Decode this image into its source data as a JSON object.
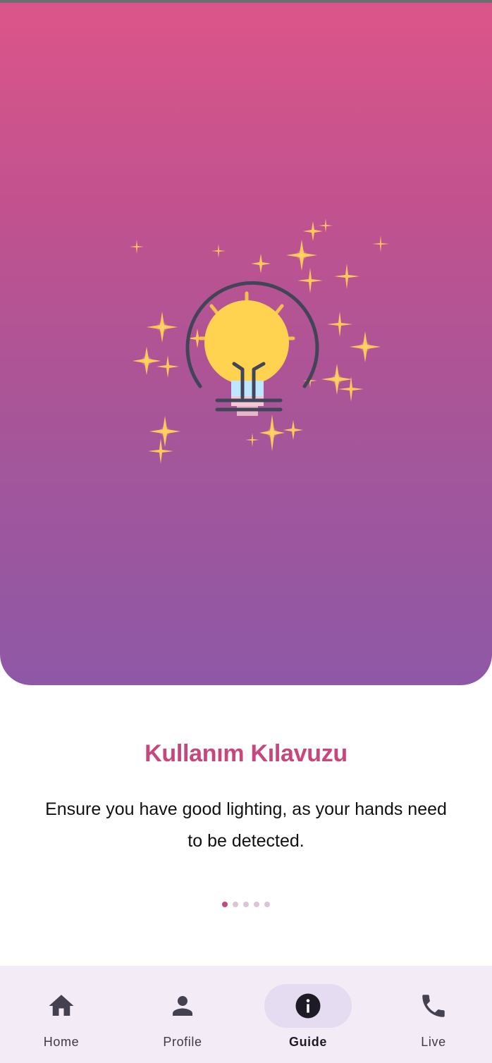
{
  "screen": {
    "title": "Kullanım Kılavuzu",
    "description": "Ensure you have good lighting, as your hands need to be detected.",
    "illustration": "lightbulb-with-sparkles",
    "pager": {
      "current": 1,
      "total": 5
    }
  },
  "colors": {
    "gradient_top": "#dc5589",
    "gradient_bottom": "#8e58a6",
    "title": "#c8467c",
    "nav_background": "#f3ebf5",
    "nav_active_pill": "#e6dcf1"
  },
  "nav": {
    "items": [
      {
        "label": "Home",
        "icon": "home-icon",
        "active": false
      },
      {
        "label": "Profile",
        "icon": "person-icon",
        "active": false
      },
      {
        "label": "Guide",
        "icon": "info-icon",
        "active": true
      },
      {
        "label": "Live",
        "icon": "phone-icon",
        "active": false
      }
    ]
  }
}
